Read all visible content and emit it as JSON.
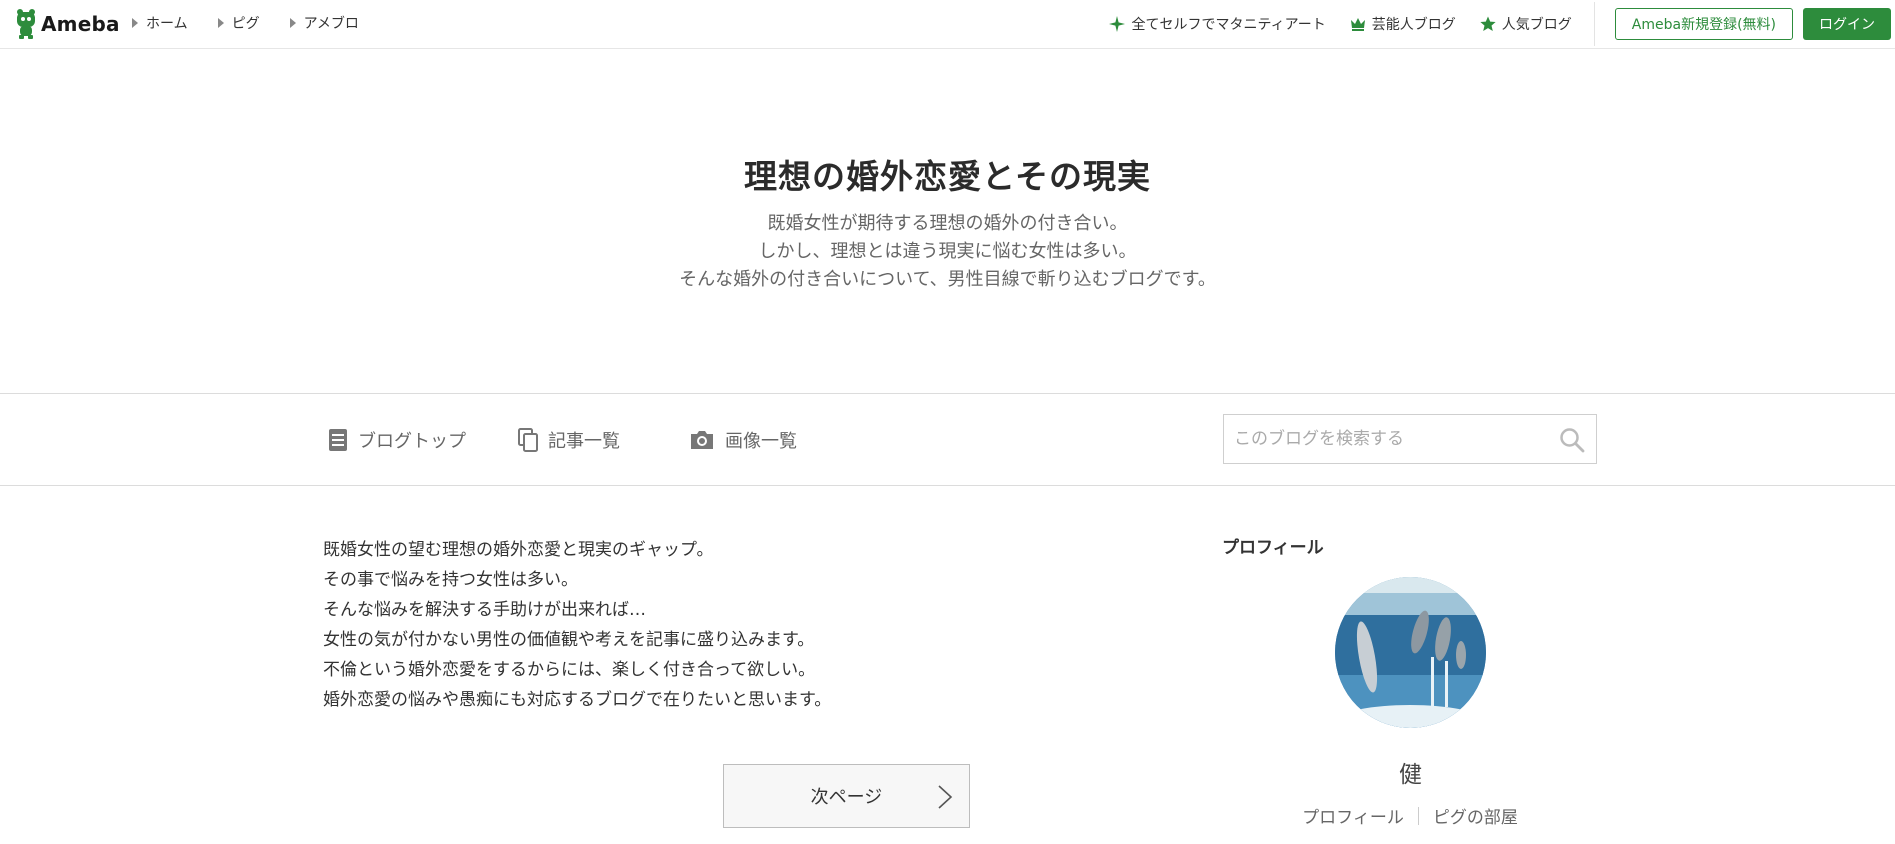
{
  "header": {
    "logo_text": "Ameba",
    "breadcrumbs": [
      "ホーム",
      "ピグ",
      "アメブロ"
    ],
    "right_links": [
      {
        "label": "全てセルフでマタニティアート",
        "icon": "sparkle-icon"
      },
      {
        "label": "芸能人ブログ",
        "icon": "crown-icon"
      },
      {
        "label": "人気ブログ",
        "icon": "star-icon"
      }
    ],
    "register_label": "Ameba新規登録(無料)",
    "login_label": "ログイン",
    "accent_color": "#2d8c3c"
  },
  "blog": {
    "title": "理想の婚外恋愛とその現実",
    "description_lines": [
      "既婚女性が期待する理想の婚外の付き合い。",
      "しかし、理想とは違う現実に悩む女性は多い。",
      "そんな婚外の付き合いについて、男性目線で斬り込むブログです。"
    ]
  },
  "blognav": {
    "items": [
      {
        "label": "ブログトップ",
        "icon": "document-icon"
      },
      {
        "label": "記事一覧",
        "icon": "copy-icon"
      },
      {
        "label": "画像一覧",
        "icon": "camera-icon"
      }
    ],
    "search_placeholder": "このブログを検索する"
  },
  "main": {
    "intro_lines": [
      "既婚女性の望む理想の婚外恋愛と現実のギャップ。",
      "その事で悩みを持つ女性は多い。",
      "そんな悩みを解決する手助けが出来れば…",
      "女性の気が付かない男性の価値観や考えを記事に盛り込みます。",
      "不倫という婚外恋愛をするからには、楽しく付き合って欲しい。",
      "婚外恋愛の悩みや愚痴にも対応するブログで在りたいと思います。"
    ],
    "next_page_label": "次ページ"
  },
  "sidebar": {
    "profile_heading": "プロフィール",
    "name": "健",
    "links": [
      "プロフィール",
      "ピグの部屋"
    ]
  }
}
